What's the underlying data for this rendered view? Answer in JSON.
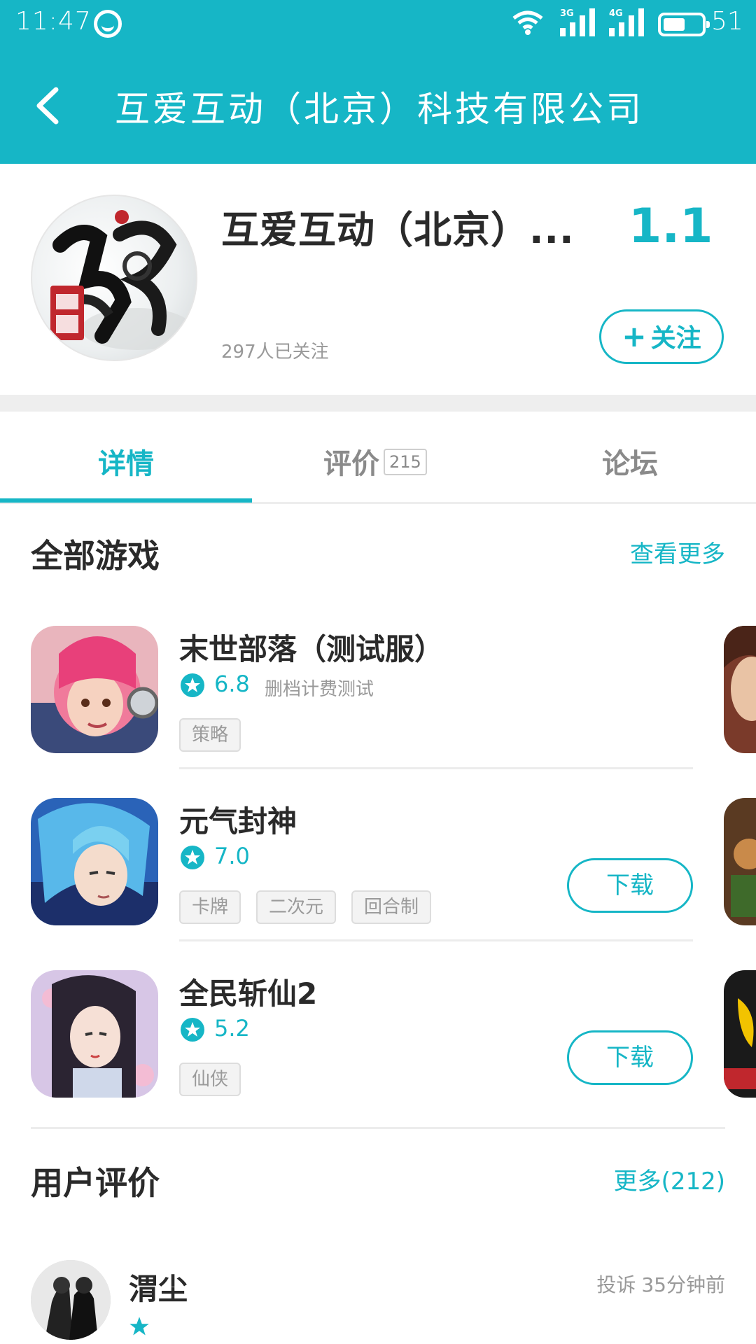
{
  "status_bar": {
    "time": "11:47",
    "net1": "3G",
    "net2": "4G",
    "battery": "51"
  },
  "header": {
    "title": "互爱互动（北京）科技有限公司"
  },
  "company": {
    "name": "互爱互动（北京）...",
    "score": "1.1",
    "followers": "297人已关注",
    "follow_label": "关注"
  },
  "tabs": [
    {
      "label": "详情",
      "active": true
    },
    {
      "label": "评价",
      "count": "215"
    },
    {
      "label": "论坛"
    }
  ],
  "games_section": {
    "title": "全部游戏",
    "more": "查看更多",
    "items": [
      {
        "name": "末世部落（测试服）",
        "rating": "6.8",
        "note": "删档计费测试",
        "tags": [
          "策略"
        ],
        "button": ""
      },
      {
        "name": "元气封神",
        "rating": "7.0",
        "note": "",
        "tags": [
          "卡牌",
          "二次元",
          "回合制"
        ],
        "button": "下载"
      },
      {
        "name": "全民斩仙2",
        "rating": "5.2",
        "note": "",
        "tags": [
          "仙侠"
        ],
        "button": "下载"
      }
    ]
  },
  "reviews_section": {
    "title": "用户评价",
    "more": "更多(212)",
    "first_review": {
      "user": "渭尘",
      "report": "投诉",
      "time": "35分钟前"
    }
  },
  "colors": {
    "accent": "#16b6c6",
    "text_dark": "#2a2a2a",
    "text_muted": "#999999"
  }
}
